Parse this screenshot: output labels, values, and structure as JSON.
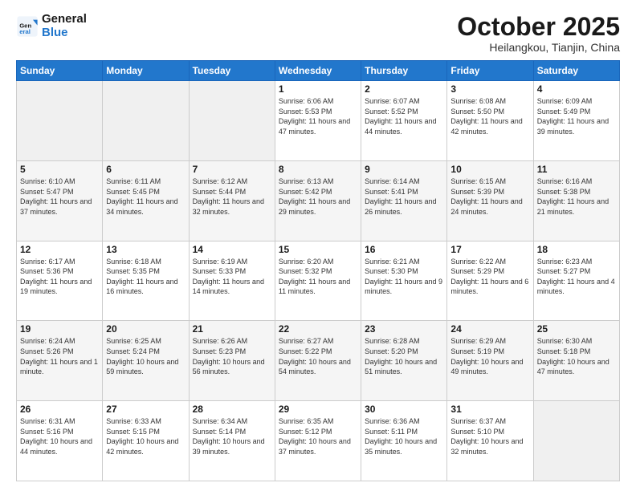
{
  "header": {
    "logo_line1": "General",
    "logo_line2": "Blue",
    "month": "October 2025",
    "location": "Heilangkou, Tianjin, China"
  },
  "weekdays": [
    "Sunday",
    "Monday",
    "Tuesday",
    "Wednesday",
    "Thursday",
    "Friday",
    "Saturday"
  ],
  "weeks": [
    [
      {
        "day": "",
        "info": ""
      },
      {
        "day": "",
        "info": ""
      },
      {
        "day": "",
        "info": ""
      },
      {
        "day": "1",
        "info": "Sunrise: 6:06 AM\nSunset: 5:53 PM\nDaylight: 11 hours and 47 minutes."
      },
      {
        "day": "2",
        "info": "Sunrise: 6:07 AM\nSunset: 5:52 PM\nDaylight: 11 hours and 44 minutes."
      },
      {
        "day": "3",
        "info": "Sunrise: 6:08 AM\nSunset: 5:50 PM\nDaylight: 11 hours and 42 minutes."
      },
      {
        "day": "4",
        "info": "Sunrise: 6:09 AM\nSunset: 5:49 PM\nDaylight: 11 hours and 39 minutes."
      }
    ],
    [
      {
        "day": "5",
        "info": "Sunrise: 6:10 AM\nSunset: 5:47 PM\nDaylight: 11 hours and 37 minutes."
      },
      {
        "day": "6",
        "info": "Sunrise: 6:11 AM\nSunset: 5:45 PM\nDaylight: 11 hours and 34 minutes."
      },
      {
        "day": "7",
        "info": "Sunrise: 6:12 AM\nSunset: 5:44 PM\nDaylight: 11 hours and 32 minutes."
      },
      {
        "day": "8",
        "info": "Sunrise: 6:13 AM\nSunset: 5:42 PM\nDaylight: 11 hours and 29 minutes."
      },
      {
        "day": "9",
        "info": "Sunrise: 6:14 AM\nSunset: 5:41 PM\nDaylight: 11 hours and 26 minutes."
      },
      {
        "day": "10",
        "info": "Sunrise: 6:15 AM\nSunset: 5:39 PM\nDaylight: 11 hours and 24 minutes."
      },
      {
        "day": "11",
        "info": "Sunrise: 6:16 AM\nSunset: 5:38 PM\nDaylight: 11 hours and 21 minutes."
      }
    ],
    [
      {
        "day": "12",
        "info": "Sunrise: 6:17 AM\nSunset: 5:36 PM\nDaylight: 11 hours and 19 minutes."
      },
      {
        "day": "13",
        "info": "Sunrise: 6:18 AM\nSunset: 5:35 PM\nDaylight: 11 hours and 16 minutes."
      },
      {
        "day": "14",
        "info": "Sunrise: 6:19 AM\nSunset: 5:33 PM\nDaylight: 11 hours and 14 minutes."
      },
      {
        "day": "15",
        "info": "Sunrise: 6:20 AM\nSunset: 5:32 PM\nDaylight: 11 hours and 11 minutes."
      },
      {
        "day": "16",
        "info": "Sunrise: 6:21 AM\nSunset: 5:30 PM\nDaylight: 11 hours and 9 minutes."
      },
      {
        "day": "17",
        "info": "Sunrise: 6:22 AM\nSunset: 5:29 PM\nDaylight: 11 hours and 6 minutes."
      },
      {
        "day": "18",
        "info": "Sunrise: 6:23 AM\nSunset: 5:27 PM\nDaylight: 11 hours and 4 minutes."
      }
    ],
    [
      {
        "day": "19",
        "info": "Sunrise: 6:24 AM\nSunset: 5:26 PM\nDaylight: 11 hours and 1 minute."
      },
      {
        "day": "20",
        "info": "Sunrise: 6:25 AM\nSunset: 5:24 PM\nDaylight: 10 hours and 59 minutes."
      },
      {
        "day": "21",
        "info": "Sunrise: 6:26 AM\nSunset: 5:23 PM\nDaylight: 10 hours and 56 minutes."
      },
      {
        "day": "22",
        "info": "Sunrise: 6:27 AM\nSunset: 5:22 PM\nDaylight: 10 hours and 54 minutes."
      },
      {
        "day": "23",
        "info": "Sunrise: 6:28 AM\nSunset: 5:20 PM\nDaylight: 10 hours and 51 minutes."
      },
      {
        "day": "24",
        "info": "Sunrise: 6:29 AM\nSunset: 5:19 PM\nDaylight: 10 hours and 49 minutes."
      },
      {
        "day": "25",
        "info": "Sunrise: 6:30 AM\nSunset: 5:18 PM\nDaylight: 10 hours and 47 minutes."
      }
    ],
    [
      {
        "day": "26",
        "info": "Sunrise: 6:31 AM\nSunset: 5:16 PM\nDaylight: 10 hours and 44 minutes."
      },
      {
        "day": "27",
        "info": "Sunrise: 6:33 AM\nSunset: 5:15 PM\nDaylight: 10 hours and 42 minutes."
      },
      {
        "day": "28",
        "info": "Sunrise: 6:34 AM\nSunset: 5:14 PM\nDaylight: 10 hours and 39 minutes."
      },
      {
        "day": "29",
        "info": "Sunrise: 6:35 AM\nSunset: 5:12 PM\nDaylight: 10 hours and 37 minutes."
      },
      {
        "day": "30",
        "info": "Sunrise: 6:36 AM\nSunset: 5:11 PM\nDaylight: 10 hours and 35 minutes."
      },
      {
        "day": "31",
        "info": "Sunrise: 6:37 AM\nSunset: 5:10 PM\nDaylight: 10 hours and 32 minutes."
      },
      {
        "day": "",
        "info": ""
      }
    ]
  ]
}
